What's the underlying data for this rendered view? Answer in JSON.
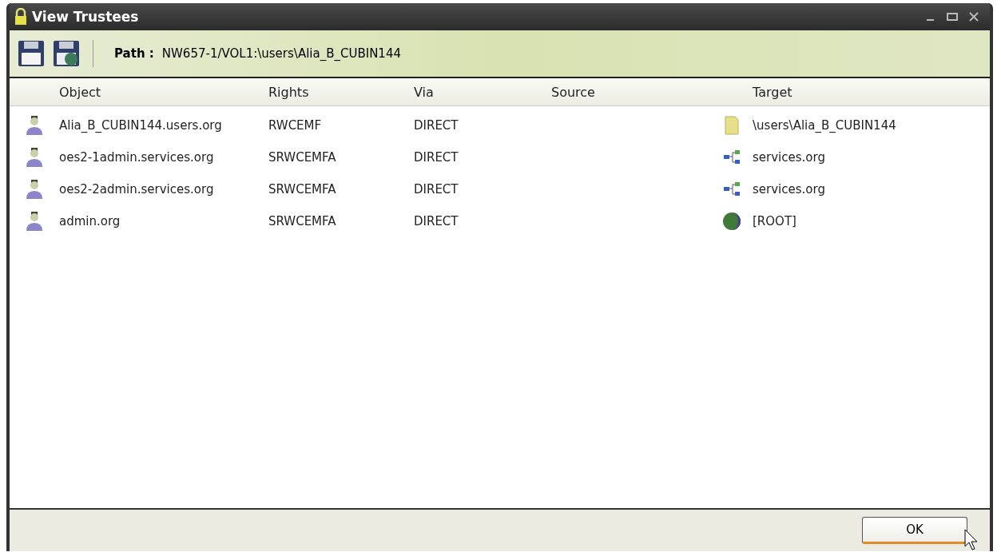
{
  "window": {
    "title": "View Trustees"
  },
  "toolbar": {
    "path_label": "Path :",
    "path": "NW657-1/VOL1:\\users\\Alia_B_CUBIN144"
  },
  "table": {
    "columns": [
      "Object",
      "Rights",
      "Via",
      "Source",
      "Target"
    ],
    "rows": [
      {
        "object": "Alia_B_CUBIN144.users.org",
        "rights": "RWCEMF",
        "via": "DIRECT",
        "target": "\\users\\Alia_B_CUBIN144",
        "kind": "folder"
      },
      {
        "object": "oes2-1admin.services.org",
        "rights": "SRWCEMFA",
        "via": "DIRECT",
        "target": "services.org",
        "kind": "container"
      },
      {
        "object": "oes2-2admin.services.org",
        "rights": "SRWCEMFA",
        "via": "DIRECT",
        "target": "services.org",
        "kind": "container"
      },
      {
        "object": "admin.org",
        "rights": "SRWCEMFA",
        "via": "DIRECT",
        "target": "[ROOT]",
        "kind": "tree"
      }
    ]
  },
  "buttons": [
    "OK"
  ]
}
